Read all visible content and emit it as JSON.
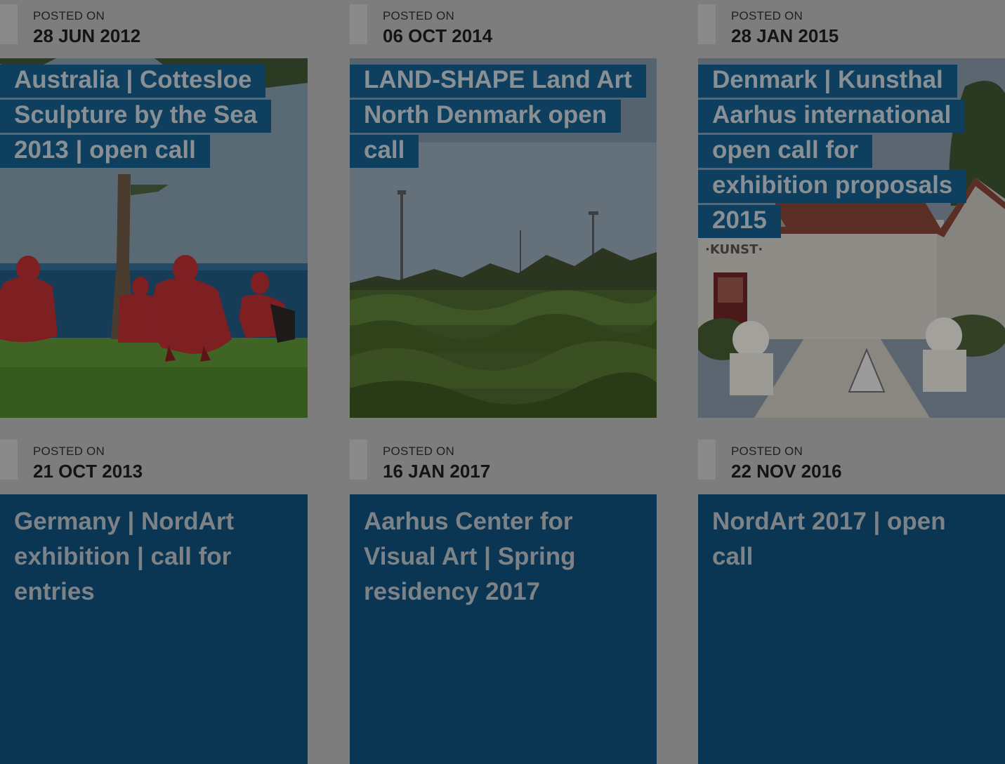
{
  "posted_label": "POSTED ON",
  "cards": [
    {
      "date": "28 JUN 2012",
      "title": "Australia | Cottesloe Sculpture by the Sea 2013 | open call",
      "image": "red-sculptures-by-sea"
    },
    {
      "date": "06 OCT 2014",
      "title": "LAND-SHAPE Land Art North Denmark open call",
      "image": "grass-mounds-landscape"
    },
    {
      "date": "28 JAN 2015",
      "title": "Denmark | Kunsthal Aarhus international open call for exhibition proposals 2015",
      "image": "kunsthal-building"
    },
    {
      "date": "21 OCT 2013",
      "title": "Germany | NordArt exhibition | call for entries"
    },
    {
      "date": "16 JAN 2017",
      "title": "Aarhus Center for Visual Art | Spring residency 2017"
    },
    {
      "date": "22 NOV 2016",
      "title": "NordArt 2017 | open call"
    }
  ],
  "image_text": {
    "kunst_sign": "·KUNST·"
  },
  "colors": {
    "overlay": "#7d7d7d",
    "title_bg": "#0e3f5e",
    "text_card_bg": "#0a3654",
    "title_text": "#8a8f94"
  }
}
